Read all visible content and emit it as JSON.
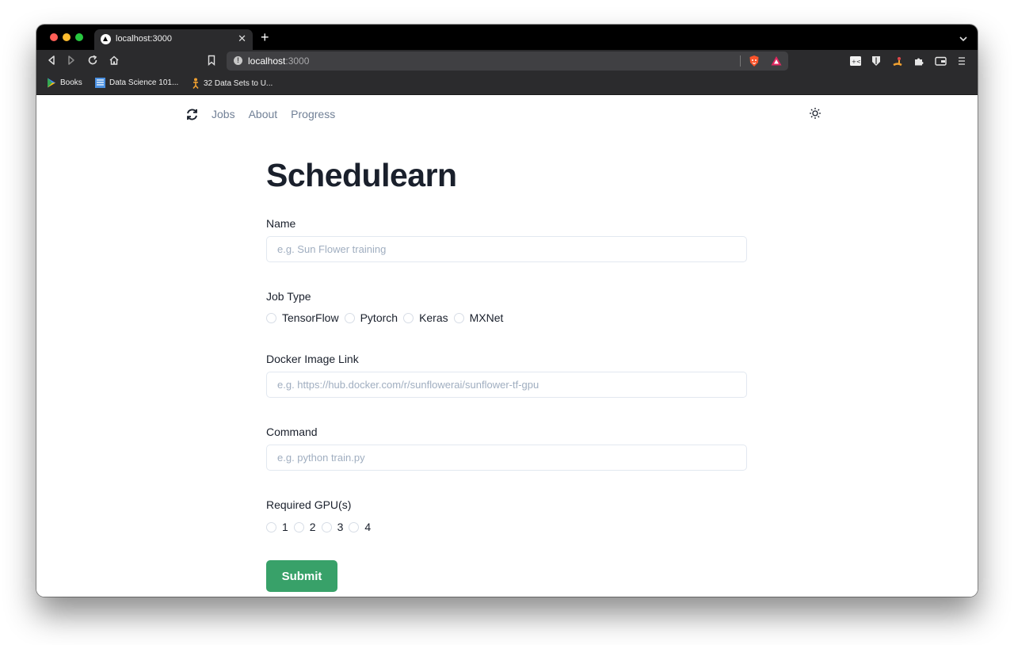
{
  "browser": {
    "tab_title": "localhost:3000",
    "url_host": "localhost",
    "url_port": ":3000",
    "bookmarks": [
      {
        "label": "Books",
        "icon": "play-books-icon"
      },
      {
        "label": "Data Science 101...",
        "icon": "bookmark-page-icon"
      },
      {
        "label": "32 Data Sets to U...",
        "icon": "figure-icon"
      }
    ]
  },
  "nav": {
    "items": [
      "Jobs",
      "About",
      "Progress"
    ],
    "logo_icon": "sync-icon",
    "theme_icon": "sun-icon"
  },
  "form": {
    "title": "Schedulearn",
    "name_label": "Name",
    "name_placeholder": "e.g. Sun Flower training",
    "job_type_label": "Job Type",
    "job_types": [
      "TensorFlow",
      "Pytorch",
      "Keras",
      "MXNet"
    ],
    "docker_label": "Docker Image Link",
    "docker_placeholder": "e.g. https://hub.docker.com/r/sunflowerai/sunflower-tf-gpu",
    "command_label": "Command",
    "command_placeholder": "e.g. python train.py",
    "gpu_label": "Required GPU(s)",
    "gpu_options": [
      "1",
      "2",
      "3",
      "4"
    ],
    "submit_label": "Submit"
  },
  "colors": {
    "accent": "#38a169",
    "nav_link": "#718096",
    "heading": "#1a202c"
  }
}
